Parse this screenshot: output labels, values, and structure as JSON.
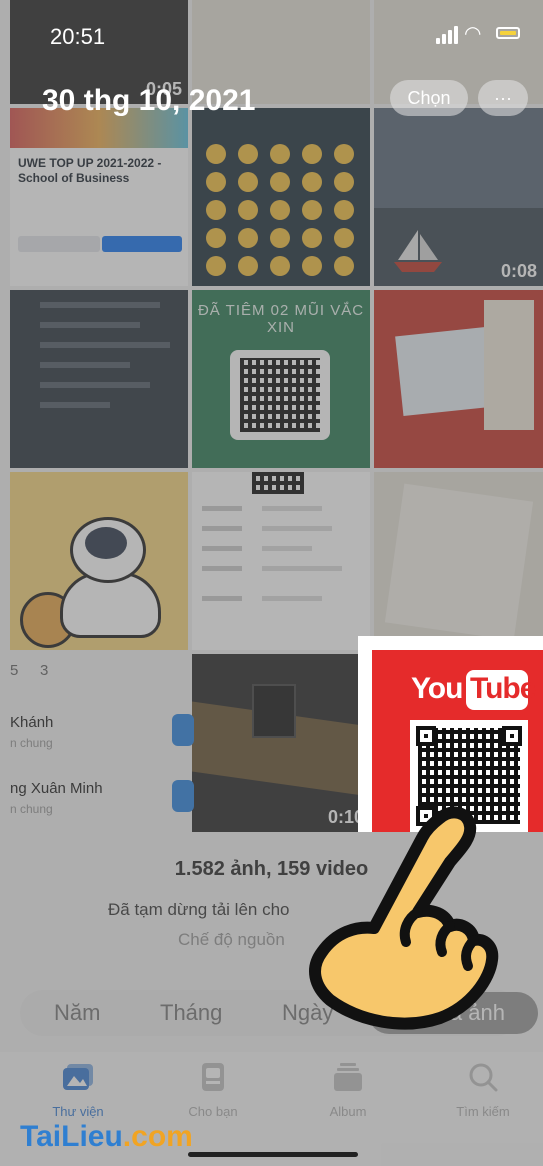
{
  "status": {
    "time": "20:51",
    "signal_bars": 4
  },
  "header": {
    "date": "30 thg 10, 2021",
    "select_label": "Chọn",
    "more_label": "···"
  },
  "grid": {
    "video_durations": [
      "0:05",
      "0:08",
      "0:10"
    ],
    "fb_post_title": "UWE TOP UP 2021-2022 - School of Business",
    "vaccine_title": "ĐÃ TIÊM 02 MŨI VẮC XIN"
  },
  "faces": {
    "count_text": "5",
    "reaction_count": "3",
    "people": [
      {
        "name": "Khánh",
        "sub": "n chung"
      },
      {
        "name": "ng Xuân Minh",
        "sub": "n chung"
      }
    ]
  },
  "summary": {
    "count": "1.582 ảnh, 159 video",
    "upload_status": "Đã tạm dừng tải lên cho",
    "upload_link": "c",
    "mode": "Chế độ nguồn"
  },
  "view_switcher": {
    "years": "Năm",
    "months": "Tháng",
    "days": "Ngày",
    "all": "Tất cả ảnh"
  },
  "tabs": [
    {
      "label": "Thư viện",
      "icon": "photos-icon",
      "active": true
    },
    {
      "label": "Cho bạn",
      "icon": "for-you-icon",
      "active": false
    },
    {
      "label": "Album",
      "icon": "album-icon",
      "active": false
    },
    {
      "label": "Tìm kiếm",
      "icon": "search-icon",
      "active": false
    }
  ],
  "overlay": {
    "youtube_you": "You",
    "youtube_tube": "Tube"
  },
  "watermark": {
    "part1": "TaiLieu",
    "part2": ".com"
  }
}
